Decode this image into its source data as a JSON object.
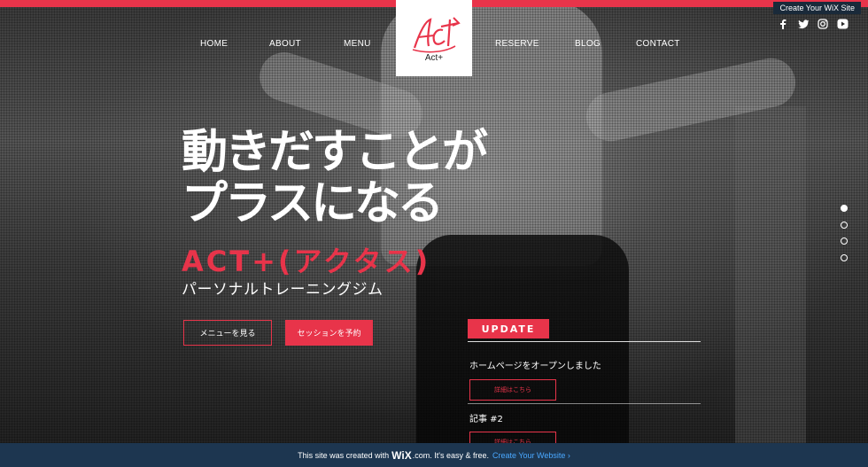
{
  "colors": {
    "accent": "#e8344a",
    "wix_banner": "#1d3650",
    "wix_cta": "#4aa8ff"
  },
  "nav": {
    "left": [
      "HOME",
      "ABOUT",
      "MENU"
    ],
    "right": [
      "RESERVE",
      "BLOG",
      "CONTACT"
    ],
    "logo_script": "Act",
    "logo_text": "Act+"
  },
  "wix_top": {
    "label": "Create Your WiX Site"
  },
  "social": [
    "facebook-icon",
    "twitter-icon",
    "instagram-icon",
    "youtube-icon"
  ],
  "hero": {
    "headline_1": "動きだすことが",
    "headline_2": "プラスになる",
    "brand": "ACT+(アクタス)",
    "subtitle": "パーソナルトレーニングジム",
    "btn_menu": "メニューを見る",
    "btn_reserve": "セッションを予約"
  },
  "update": {
    "label": "UPDATE",
    "posts": [
      {
        "title": "ホームページをオープンしました",
        "link": "詳細はこちら"
      },
      {
        "title": "記事 #2",
        "link": "詳細はこちら"
      }
    ]
  },
  "slides": {
    "count": 4,
    "active": 0
  },
  "wix_bottom": {
    "pre": "This site was created with",
    "logo": "WiX",
    "domain": ".com. It's easy & free.",
    "cta": "Create Your Website ›"
  }
}
